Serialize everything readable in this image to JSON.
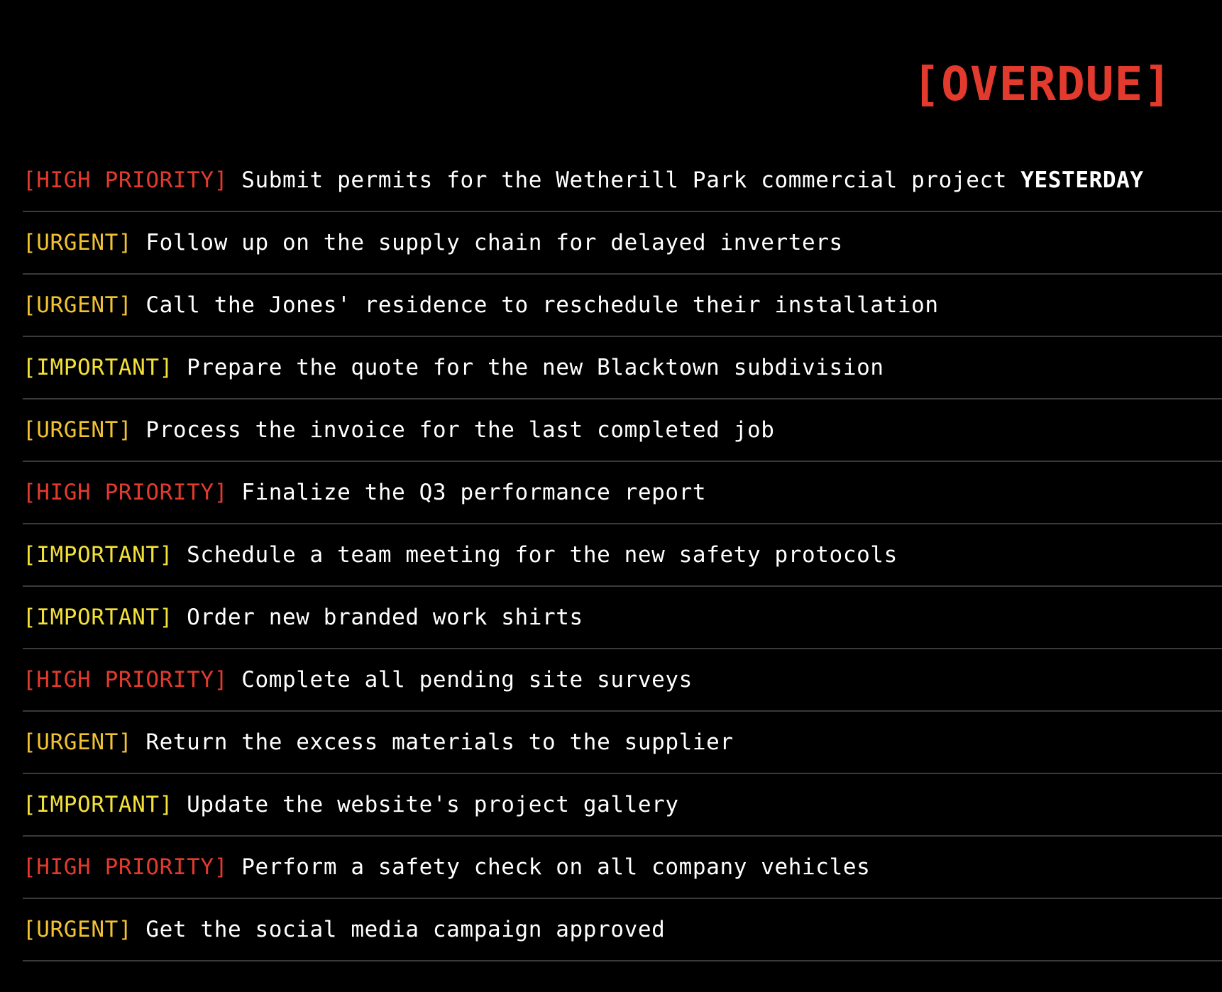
{
  "header": {
    "title": "[OVERDUE]"
  },
  "colors": {
    "high": "#e23b2e",
    "urgent": "#f1c232",
    "important": "#f3e13a",
    "text": "#ffffff",
    "background": "#000000",
    "divider": "#3a3a3a"
  },
  "tasks": [
    {
      "tag": "[HIGH PRIORITY]",
      "level": "high",
      "text": "Submit permits for the Wetherill Park commercial project",
      "emphasis": "YESTERDAY"
    },
    {
      "tag": "[URGENT]",
      "level": "urgent",
      "text": "Follow up on the supply chain for delayed inverters",
      "emphasis": ""
    },
    {
      "tag": "[URGENT]",
      "level": "urgent",
      "text": "Call the Jones' residence to reschedule their installation",
      "emphasis": ""
    },
    {
      "tag": "[IMPORTANT]",
      "level": "important",
      "text": "Prepare the quote for the new Blacktown subdivision",
      "emphasis": ""
    },
    {
      "tag": "[URGENT]",
      "level": "urgent",
      "text": "Process the invoice for the last completed job",
      "emphasis": ""
    },
    {
      "tag": "[HIGH PRIORITY]",
      "level": "high",
      "text": "Finalize the Q3 performance report",
      "emphasis": ""
    },
    {
      "tag": "[IMPORTANT]",
      "level": "important",
      "text": "Schedule a team meeting for the new safety protocols",
      "emphasis": ""
    },
    {
      "tag": "[IMPORTANT]",
      "level": "important",
      "text": "Order new branded work shirts",
      "emphasis": ""
    },
    {
      "tag": "[HIGH PRIORITY]",
      "level": "high",
      "text": "Complete all pending site surveys",
      "emphasis": ""
    },
    {
      "tag": "[URGENT]",
      "level": "urgent",
      "text": "Return the excess materials to the supplier",
      "emphasis": ""
    },
    {
      "tag": "[IMPORTANT]",
      "level": "important",
      "text": "Update the website's project gallery",
      "emphasis": ""
    },
    {
      "tag": "[HIGH PRIORITY]",
      "level": "high",
      "text": "Perform a safety check on all company vehicles",
      "emphasis": ""
    },
    {
      "tag": "[URGENT]",
      "level": "urgent",
      "text": "Get the social media campaign approved",
      "emphasis": ""
    }
  ]
}
